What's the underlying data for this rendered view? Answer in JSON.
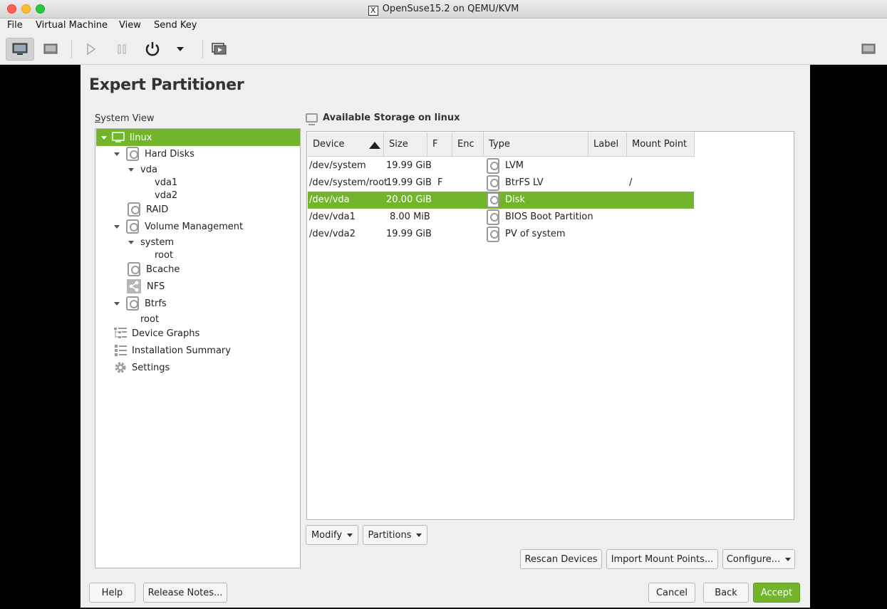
{
  "window": {
    "title": "OpenSuse15.2 on QEMU/KVM",
    "x_glyph": "X"
  },
  "menu": [
    "File",
    "Virtual Machine",
    "View",
    "Send Key"
  ],
  "installer": {
    "page_title": "Expert Partitioner",
    "system_view_label": "System View",
    "tree": {
      "root": "linux",
      "hard_disks": "Hard Disks",
      "vda": "vda",
      "vda1": "vda1",
      "vda2": "vda2",
      "raid": "RAID",
      "volume_management": "Volume Management",
      "system": "system",
      "system_root": "root",
      "bcache": "Bcache",
      "nfs": "NFS",
      "btrfs": "Btrfs",
      "btrfs_root": "root",
      "device_graphs": "Device Graphs",
      "installation_summary": "Installation Summary",
      "settings": "Settings"
    },
    "storage_heading": "Available Storage on linux",
    "columns": [
      "Device",
      "Size",
      "F",
      "Enc",
      "Type",
      "Label",
      "Mount Point"
    ],
    "rows": [
      {
        "device": "/dev/system",
        "size": "19.99 GiB",
        "f": "",
        "enc": "",
        "type": "LVM",
        "label": "",
        "mount": ""
      },
      {
        "device": "/dev/system/root",
        "size": "19.99 GiB",
        "f": "F",
        "enc": "",
        "type": "BtrFS LV",
        "label": "",
        "mount": "/"
      },
      {
        "device": "/dev/vda",
        "size": "20.00 GiB",
        "f": "",
        "enc": "",
        "type": "Disk",
        "label": "",
        "mount": ""
      },
      {
        "device": "/dev/vda1",
        "size": "8.00 MiB",
        "f": "",
        "enc": "",
        "type": "BIOS Boot Partition",
        "label": "",
        "mount": ""
      },
      {
        "device": "/dev/vda2",
        "size": "19.99 GiB",
        "f": "",
        "enc": "",
        "type": "PV of system",
        "label": "",
        "mount": ""
      }
    ],
    "buttons": {
      "modify": "Modify",
      "partitions": "Partitions",
      "rescan": "Rescan Devices",
      "import": "Import Mount Points...",
      "configure": "Configure...",
      "help": "Help",
      "release_notes": "Release Notes...",
      "cancel": "Cancel",
      "back": "Back",
      "accept": "Accept"
    }
  },
  "colors": {
    "accent": "#72b52c"
  }
}
